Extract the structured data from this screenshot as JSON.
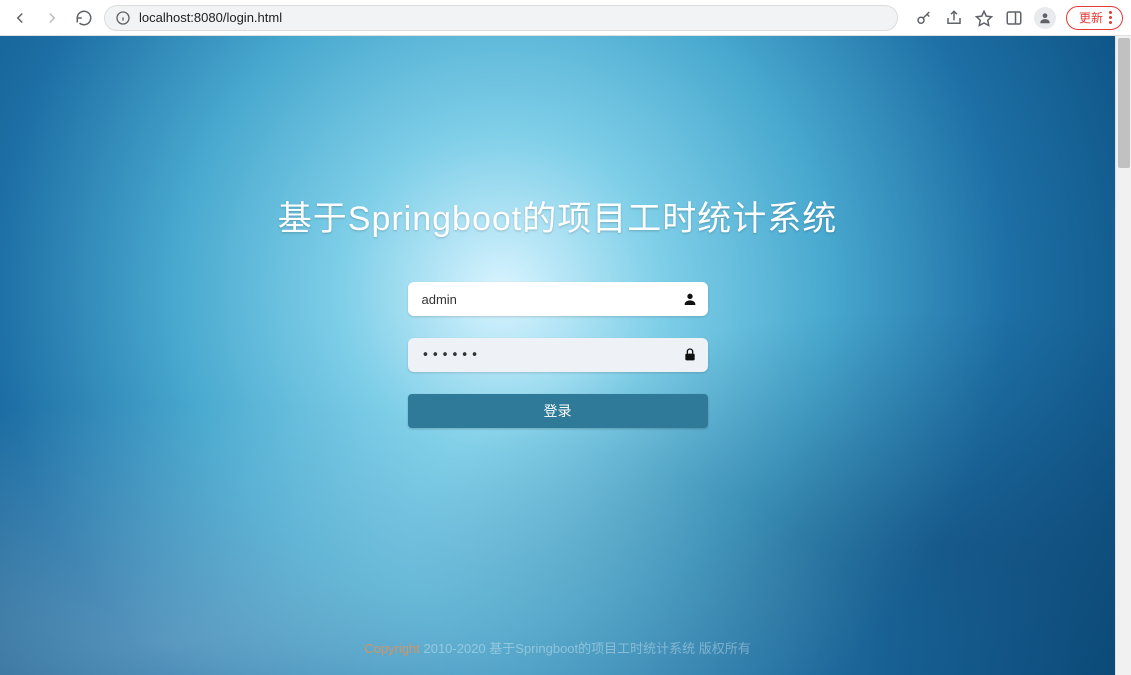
{
  "browser": {
    "url": "localhost:8080/login.html",
    "update_label": "更新"
  },
  "login": {
    "title": "基于Springboot的项目工时统计系统",
    "username_value": "admin",
    "password_value": "••••••",
    "submit_label": "登录"
  },
  "footer": {
    "copyright_word": "Copyright",
    "rest": " 2010-2020 基于Springboot的项目工时统计系统 版权所有"
  }
}
